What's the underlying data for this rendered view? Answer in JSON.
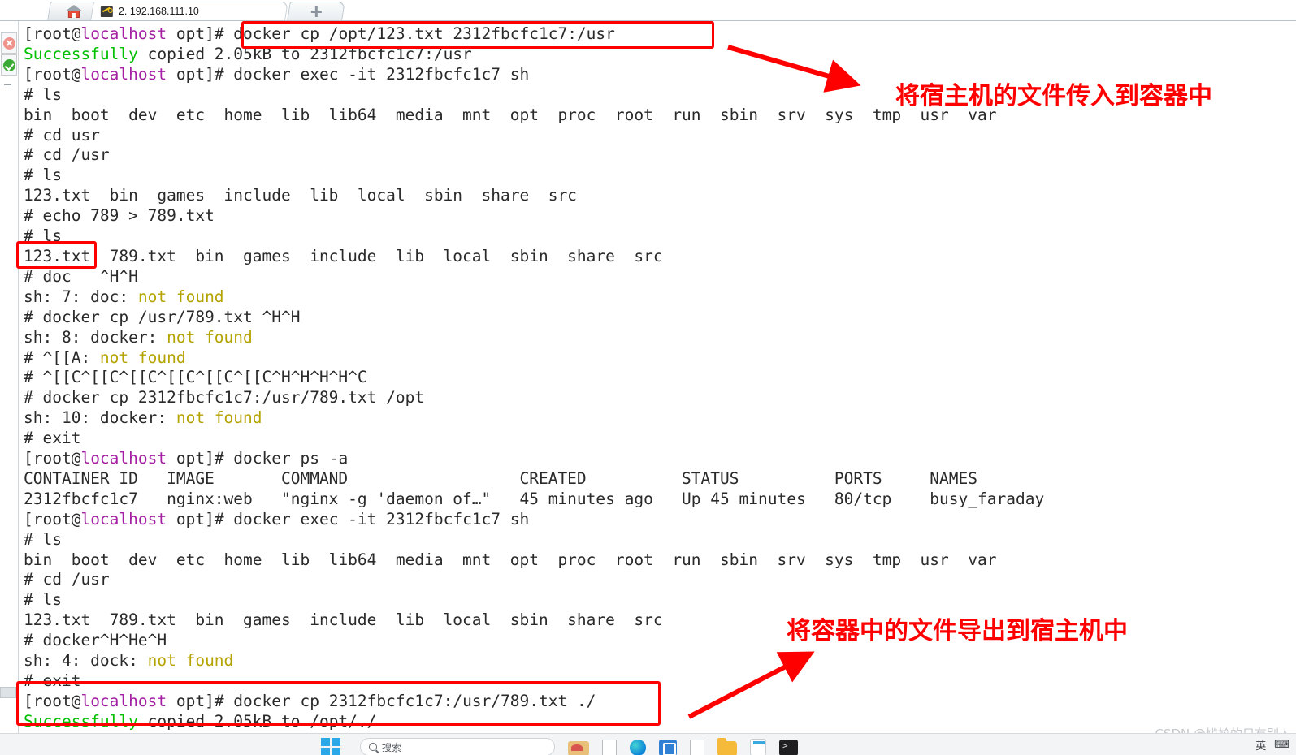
{
  "window": {
    "tabs": [
      {
        "name": "home-tab",
        "label": "",
        "icon": "home-icon"
      },
      {
        "name": "session-tab",
        "label": "2. 192.168.111.10",
        "icon": "key-icon"
      },
      {
        "name": "new-tab",
        "label": "",
        "icon": "plus-icon"
      }
    ]
  },
  "sidebar": {
    "buttons": [
      {
        "label": "",
        "icon": "disconnect-icon"
      },
      {
        "label": "",
        "icon": "connect-icon"
      }
    ]
  },
  "terminal": {
    "lines": [
      {
        "segments": [
          {
            "t": "[root@",
            "c": "prompt"
          },
          {
            "t": "localhost",
            "c": "host"
          },
          {
            "t": " opt]# docker cp /opt/123.txt 2312fbcfc1c7:/usr",
            "c": "prompt"
          }
        ]
      },
      {
        "segments": [
          {
            "t": "Successfully",
            "c": "success"
          },
          {
            "t": " copied 2.05kB to 2312fbcfc1c7:/usr",
            "c": "prompt"
          }
        ]
      },
      {
        "segments": [
          {
            "t": "[root@",
            "c": "prompt"
          },
          {
            "t": "localhost",
            "c": "host"
          },
          {
            "t": " opt]# docker exec -it 2312fbcfc1c7 sh",
            "c": "prompt"
          }
        ]
      },
      {
        "segments": [
          {
            "t": "# ls",
            "c": "prompt"
          }
        ]
      },
      {
        "segments": [
          {
            "t": "bin  boot  dev  etc  home  lib  lib64  media  mnt  opt  proc  root  run  sbin  srv  sys  tmp  usr  var",
            "c": "prompt"
          }
        ]
      },
      {
        "segments": [
          {
            "t": "# cd usr",
            "c": "prompt"
          }
        ]
      },
      {
        "segments": [
          {
            "t": "# cd /usr",
            "c": "prompt"
          }
        ]
      },
      {
        "segments": [
          {
            "t": "# ls",
            "c": "prompt"
          }
        ]
      },
      {
        "segments": [
          {
            "t": "123.txt  bin  games  include  lib  local  sbin  share  src",
            "c": "prompt"
          }
        ]
      },
      {
        "segments": [
          {
            "t": "# echo 789 > 789.txt",
            "c": "prompt"
          }
        ]
      },
      {
        "segments": [
          {
            "t": "# ls",
            "c": "prompt"
          }
        ]
      },
      {
        "segments": [
          {
            "t": "123.txt  789.txt  bin  games  include  lib  local  sbin  share  src",
            "c": "prompt"
          }
        ]
      },
      {
        "segments": [
          {
            "t": "# doc   ^H^H",
            "c": "prompt"
          }
        ]
      },
      {
        "segments": [
          {
            "t": "sh: 7: doc: ",
            "c": "prompt"
          },
          {
            "t": "not found",
            "c": "warn"
          }
        ]
      },
      {
        "segments": [
          {
            "t": "# docker cp /usr/789.txt ^H^H",
            "c": "prompt"
          }
        ]
      },
      {
        "segments": [
          {
            "t": "sh: 8: docker: ",
            "c": "prompt"
          },
          {
            "t": "not found",
            "c": "warn"
          }
        ]
      },
      {
        "segments": [
          {
            "t": "# ^[[A: ",
            "c": "prompt"
          },
          {
            "t": "not found",
            "c": "warn"
          }
        ]
      },
      {
        "segments": [
          {
            "t": "# ^[[C^[[C^[[C^[[C^[[C^[[C^H^H^H^H^C",
            "c": "prompt"
          }
        ]
      },
      {
        "segments": [
          {
            "t": "# docker cp 2312fbcfc1c7:/usr/789.txt /opt",
            "c": "prompt"
          }
        ]
      },
      {
        "segments": [
          {
            "t": "sh: 10: docker: ",
            "c": "prompt"
          },
          {
            "t": "not found",
            "c": "warn"
          }
        ]
      },
      {
        "segments": [
          {
            "t": "# exit",
            "c": "prompt"
          }
        ]
      },
      {
        "segments": [
          {
            "t": "[root@",
            "c": "prompt"
          },
          {
            "t": "localhost",
            "c": "host"
          },
          {
            "t": " opt]# docker ps -a",
            "c": "prompt"
          }
        ]
      },
      {
        "segments": [
          {
            "t": "CONTAINER ID   IMAGE       COMMAND                  CREATED          STATUS          PORTS     NAMES",
            "c": "prompt"
          }
        ]
      },
      {
        "segments": [
          {
            "t": "2312fbcfc1c7   nginx:web   \"nginx -g 'daemon of…\"   45 minutes ago   Up 45 minutes   80/tcp    busy_faraday",
            "c": "prompt"
          }
        ]
      },
      {
        "segments": [
          {
            "t": "[root@",
            "c": "prompt"
          },
          {
            "t": "localhost",
            "c": "host"
          },
          {
            "t": " opt]# docker exec -it 2312fbcfc1c7 sh",
            "c": "prompt"
          }
        ]
      },
      {
        "segments": [
          {
            "t": "# ls",
            "c": "prompt"
          }
        ]
      },
      {
        "segments": [
          {
            "t": "bin  boot  dev  etc  home  lib  lib64  media  mnt  opt  proc  root  run  sbin  srv  sys  tmp  usr  var",
            "c": "prompt"
          }
        ]
      },
      {
        "segments": [
          {
            "t": "# cd /usr",
            "c": "prompt"
          }
        ]
      },
      {
        "segments": [
          {
            "t": "# ls",
            "c": "prompt"
          }
        ]
      },
      {
        "segments": [
          {
            "t": "123.txt  789.txt  bin  games  include  lib  local  sbin  share  src",
            "c": "prompt"
          }
        ]
      },
      {
        "segments": [
          {
            "t": "# docker^H^He^H",
            "c": "prompt"
          }
        ]
      },
      {
        "segments": [
          {
            "t": "sh: 4: dock: ",
            "c": "prompt"
          },
          {
            "t": "not found",
            "c": "warn"
          }
        ]
      },
      {
        "segments": [
          {
            "t": "# exit",
            "c": "prompt"
          }
        ]
      },
      {
        "segments": [
          {
            "t": "[root@",
            "c": "prompt"
          },
          {
            "t": "localhost",
            "c": "host"
          },
          {
            "t": " opt]# docker cp 2312fbcfc1c7:/usr/789.txt ./",
            "c": "prompt"
          }
        ]
      },
      {
        "segments": [
          {
            "t": "Successfully",
            "c": "success"
          },
          {
            "t": " copied 2.05kB to /opt/./",
            "c": "prompt"
          }
        ]
      }
    ]
  },
  "annotations": {
    "import_label": "将宿主机的文件传入到容器中",
    "export_label": "将容器中的文件导出到宿主机中",
    "highlight_color": "#ff0000"
  },
  "watermark": {
    "text": "CSDN @尴尬的只有别人"
  },
  "taskbar": {
    "search_placeholder": "搜索",
    "items": [
      "start-icon",
      "search-box",
      "paint-icon",
      "doc-icon",
      "edge-icon",
      "store-icon",
      "file-icon",
      "folder-icon",
      "calculator-icon",
      "terminal-icon"
    ],
    "tray": [
      "英",
      "keyboard-icon"
    ]
  }
}
